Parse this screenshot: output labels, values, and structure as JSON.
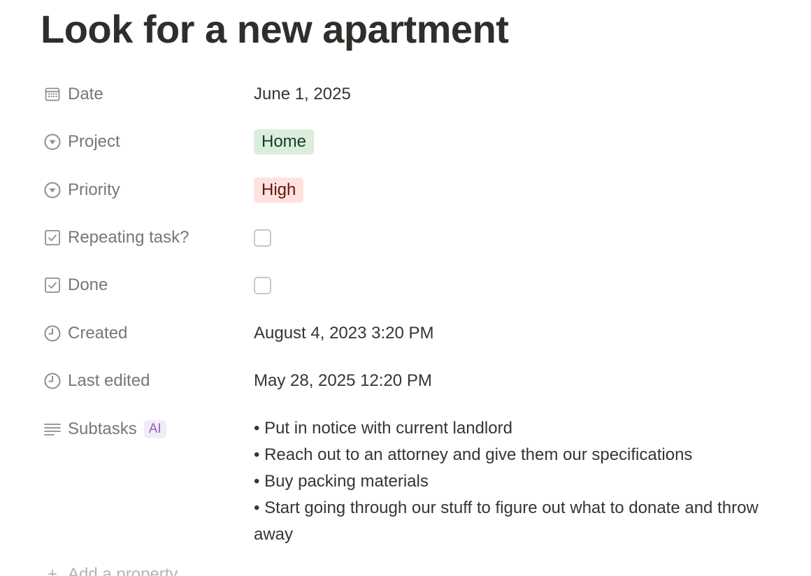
{
  "page": {
    "title": "Look for a new apartment"
  },
  "properties": {
    "date": {
      "label": "Date",
      "icon": "calendar-icon",
      "value": "June 1, 2025"
    },
    "project": {
      "label": "Project",
      "icon": "select-icon",
      "value": "Home",
      "color": "#dbeddb"
    },
    "priority": {
      "label": "Priority",
      "icon": "select-icon",
      "value": "High",
      "color": "#ffe2dd"
    },
    "repeating": {
      "label": "Repeating task?",
      "icon": "checkbox-icon",
      "checked": false
    },
    "done": {
      "label": "Done",
      "icon": "checkbox-icon",
      "checked": false
    },
    "created": {
      "label": "Created",
      "icon": "clock-icon",
      "value": "August 4, 2023 3:20 PM"
    },
    "last_edited": {
      "label": "Last edited",
      "icon": "clock-icon",
      "value": "May 28, 2025 12:20 PM"
    },
    "subtasks": {
      "label": "Subtasks",
      "icon": "text-icon",
      "badge": "AI",
      "items": [
        "• Put in notice with current landlord",
        "• Reach out to an attorney and give them our specifications",
        "• Buy packing materials",
        "• Start going through our stuff to figure out what to donate and throw away"
      ]
    }
  },
  "add_property": {
    "label": "Add a property"
  }
}
